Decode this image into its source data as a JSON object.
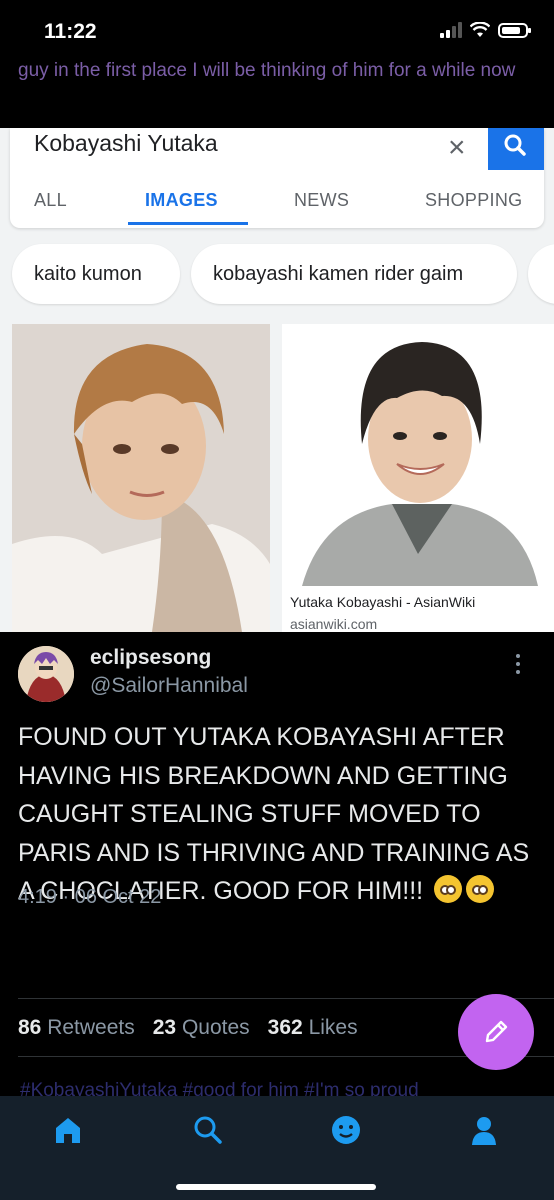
{
  "status_bar": {
    "time": "11:22"
  },
  "previous_tweet": {
    "text": "guy in the first place I will be thinking of him for a while now"
  },
  "screenshot": {
    "search_query": "Kobayashi Yutaka",
    "tabs": [
      "ALL",
      "IMAGES",
      "NEWS",
      "SHOPPING"
    ],
    "active_tab": "IMAGES",
    "chips": [
      "kaito kumon",
      "kobayashi kamen rider gaim"
    ],
    "result": {
      "title": "Yutaka Kobayashi - AsianWiki",
      "source": "asianwiki.com"
    }
  },
  "tweet": {
    "display_name": "eclipsesong",
    "handle": "@SailorHannibal",
    "text": "FOUND OUT YUTAKA KOBAYASHI AFTER HAVING HIS BREAKDOWN AND GETTING CAUGHT STEALING STUFF MOVED TO PARIS AND IS THRIVING AND TRAINING AS A CHOCLATIER. GOOD FOR HIM!!!",
    "timestamp": "4:19 · 06 Oct 22",
    "stats": {
      "retweets_count": "86",
      "retweets_label": "Retweets",
      "quotes_count": "23",
      "quotes_label": "Quotes",
      "likes_count": "362",
      "likes_label": "Likes"
    }
  },
  "next_tweet_preview": {
    "text": "#KobayashiYutaka #good for him #I'm so proud"
  },
  "colors": {
    "accent": "#1d9bf0",
    "fab": "#c264f0",
    "tabbar": "#15202b"
  },
  "icons": [
    "home-icon",
    "search-icon",
    "spaces-icon",
    "profile-icon",
    "compose-icon"
  ]
}
